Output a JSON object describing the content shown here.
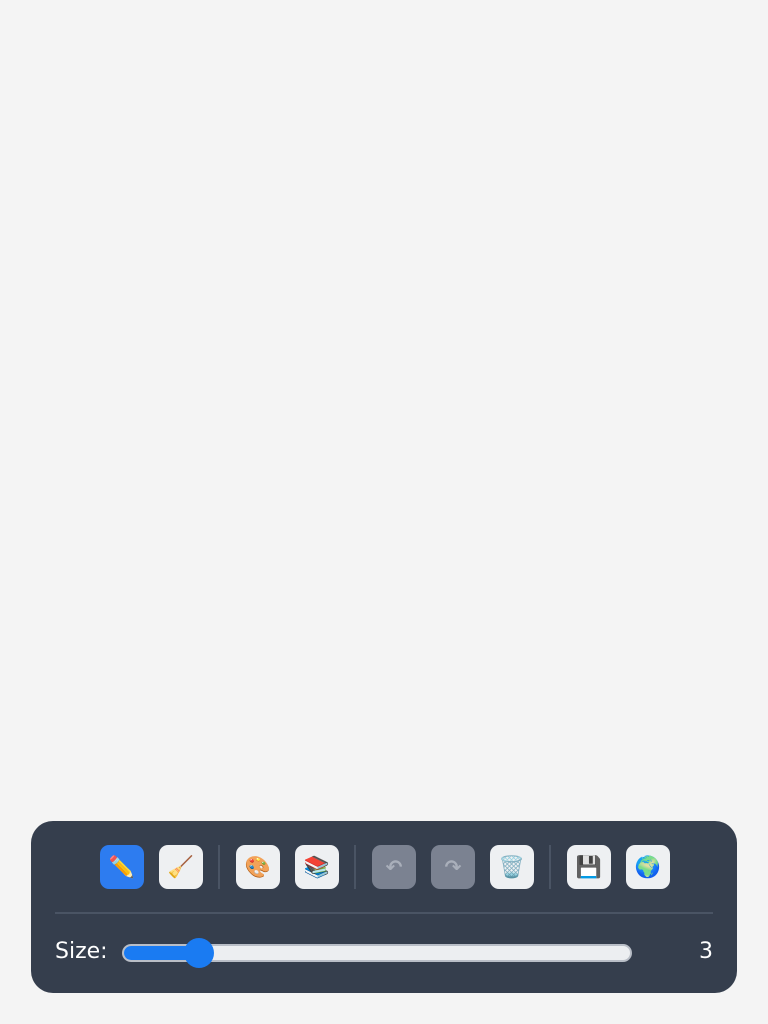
{
  "toolbar": {
    "tools": [
      {
        "name": "pencil",
        "glyph": "✏️",
        "state": "active"
      },
      {
        "name": "broom",
        "glyph": "🧹",
        "state": "normal"
      },
      {
        "name": "palette",
        "glyph": "🎨",
        "state": "normal"
      },
      {
        "name": "books",
        "glyph": "📚",
        "state": "normal"
      },
      {
        "name": "undo",
        "glyph": "↶",
        "state": "disabled"
      },
      {
        "name": "redo",
        "glyph": "↷",
        "state": "disabled"
      },
      {
        "name": "trash",
        "glyph": "🗑️",
        "state": "normal"
      },
      {
        "name": "floppy-disk",
        "glyph": "💾",
        "state": "normal"
      },
      {
        "name": "globe",
        "glyph": "🌍",
        "state": "normal"
      }
    ],
    "accent_color": "#2d7cf0"
  },
  "size": {
    "label": "Size:",
    "value": "3",
    "fraction": 0.13
  },
  "colors": {
    "panel": "#353e4d",
    "background": "#f4f4f4",
    "slider_accent": "#1a7bf2"
  }
}
